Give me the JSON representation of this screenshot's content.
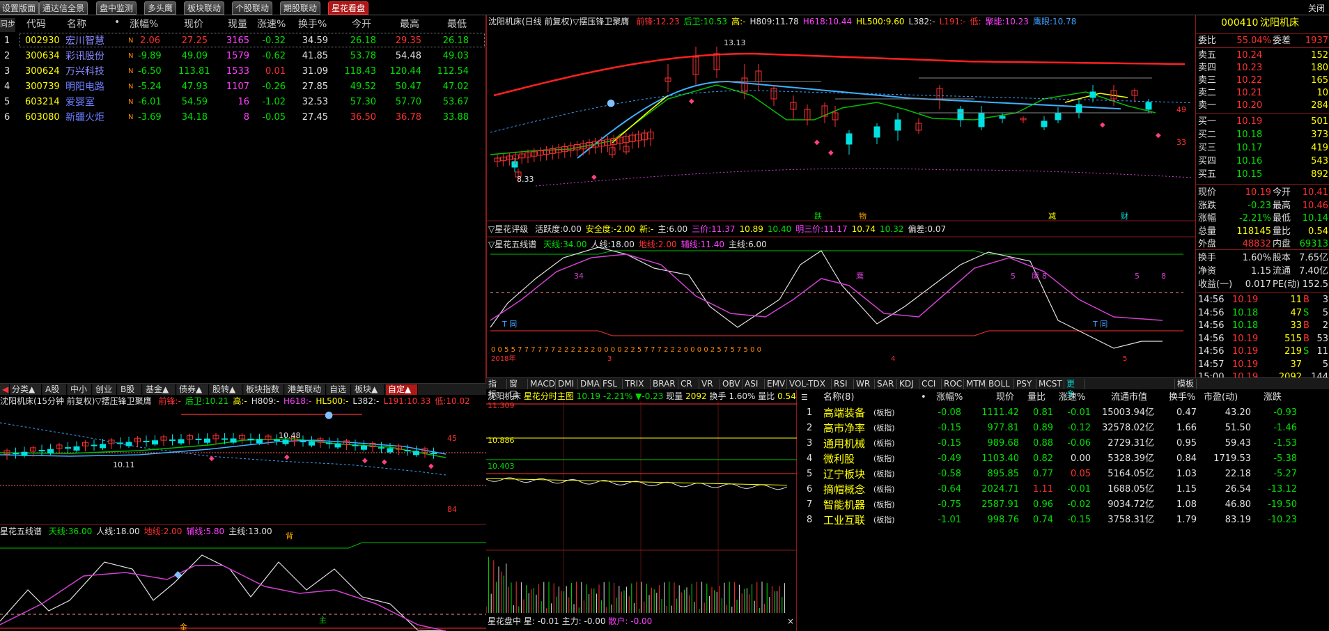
{
  "top_tabs": [
    {
      "label": "设置版面",
      "active": false
    },
    {
      "label": "通达信全景",
      "active": false
    },
    {
      "label": "盘中监测",
      "active": false
    },
    {
      "label": "多头鹰",
      "active": false
    },
    {
      "label": "板块联动",
      "active": false
    },
    {
      "label": "个股联动",
      "active": false
    },
    {
      "label": "期股联动",
      "active": false
    },
    {
      "label": "星花看盘",
      "active": true
    }
  ],
  "close_label": "关闭",
  "watchlist": {
    "headers": {
      "sync": "同步",
      "code": "代码",
      "name": "名称",
      "dot": "•",
      "chg": "涨幅%",
      "price": "现价",
      "vol": "现量",
      "speed": "涨速%",
      "turnover": "换手%",
      "open": "今开",
      "high": "最高",
      "low": "最低"
    },
    "rows": [
      {
        "idx": "1",
        "code": "002930",
        "name": "宏川智慧",
        "flag": "N",
        "chg": "2.06",
        "price": "27.25",
        "vol": "3165",
        "speed": "-0.32",
        "turnover": "34.59",
        "open": "26.18",
        "high": "29.35",
        "low": "26.18"
      },
      {
        "idx": "2",
        "code": "300634",
        "name": "彩讯股份",
        "flag": "N",
        "chg": "-9.89",
        "price": "49.09",
        "vol": "1579",
        "speed": "-0.62",
        "turnover": "41.85",
        "open": "53.78",
        "high": "54.48",
        "low": "49.03"
      },
      {
        "idx": "3",
        "code": "300624",
        "name": "万兴科技",
        "flag": "N",
        "chg": "-6.50",
        "price": "113.81",
        "vol": "1533",
        "speed": "0.01",
        "turnover": "31.09",
        "open": "118.43",
        "high": "120.44",
        "low": "112.54"
      },
      {
        "idx": "4",
        "code": "300739",
        "name": "明阳电路",
        "flag": "N",
        "chg": "-5.24",
        "price": "47.93",
        "vol": "1107",
        "speed": "-0.26",
        "turnover": "27.85",
        "open": "49.52",
        "high": "50.47",
        "low": "47.02"
      },
      {
        "idx": "5",
        "code": "603214",
        "name": "爱婴室",
        "flag": "N",
        "chg": "-6.01",
        "price": "54.59",
        "vol": "16",
        "speed": "-1.02",
        "turnover": "32.53",
        "open": "57.30",
        "high": "57.70",
        "low": "53.67"
      },
      {
        "idx": "6",
        "code": "603080",
        "name": "新疆火炬",
        "flag": "N",
        "chg": "-3.69",
        "price": "34.18",
        "vol": "8",
        "speed": "-0.05",
        "turnover": "27.45",
        "open": "36.50",
        "high": "36.78",
        "low": "33.88"
      }
    ]
  },
  "bottom_tabs": [
    {
      "label": "分类▲"
    },
    {
      "label": "A股"
    },
    {
      "label": "中小"
    },
    {
      "label": "创业"
    },
    {
      "label": "B股"
    },
    {
      "label": "基金▲"
    },
    {
      "label": "债券▲"
    },
    {
      "label": "股转▲"
    },
    {
      "label": "板块指数"
    },
    {
      "label": "港美联动"
    },
    {
      "label": "自选"
    },
    {
      "label": "板块▲"
    },
    {
      "label": "自定▲",
      "active": true
    }
  ],
  "main_chart": {
    "title": "沈阳机床(日线 前复权)▽摆压锋卫聚膺",
    "legend": [
      {
        "k": "前锋:",
        "v": "12.23",
        "c": "#ff3030"
      },
      {
        "k": "后卫:",
        "v": "10.53",
        "c": "#00e000"
      },
      {
        "k": "高:",
        "v": "-",
        "c": "#ffff00"
      },
      {
        "k": "H809:",
        "v": "11.78",
        "c": "#e0e0e0"
      },
      {
        "k": "H618:",
        "v": "10.44",
        "c": "#ff40ff"
      },
      {
        "k": "HL500:",
        "v": "9.60",
        "c": "#ffff00"
      },
      {
        "k": "L382:",
        "v": "-",
        "c": "#e0e0e0"
      },
      {
        "k": "L191:",
        "v": "-",
        "c": "#ff3030"
      },
      {
        "k": "低:",
        "v": "",
        "c": "#ff3030"
      },
      {
        "k": "聚能:",
        "v": "10.23",
        "c": "#ff40ff"
      },
      {
        "k": "鹰眼:",
        "v": "10.78",
        "c": "#40a0ff"
      }
    ],
    "annot_high": "13.13",
    "annot_low": "8.33",
    "annot_49": "49",
    "annot_33": "33",
    "signals": [
      "跌",
      "物",
      "减",
      "财"
    ],
    "rating": {
      "title": "▽星花评级",
      "items": [
        {
          "k": "活跃度:",
          "v": "0.00",
          "c": "#e0e0e0"
        },
        {
          "k": "安全度:",
          "v": "-2.00",
          "c": "#ffff00"
        },
        {
          "k": "新:",
          "v": "-",
          "c": "#ffff00"
        },
        {
          "k": "主:",
          "v": "6.00",
          "c": "#e0e0e0"
        },
        {
          "k": "三价:",
          "v": "11.37",
          "c": "#ff40ff"
        },
        {
          "k": "",
          "v": "10.89",
          "c": "#ffff00"
        },
        {
          "k": "",
          "v": "10.40",
          "c": "#00e000"
        },
        {
          "k": "明三价:",
          "v": "11.17",
          "c": "#ff40ff"
        },
        {
          "k": "",
          "v": "10.74",
          "c": "#ffff00"
        },
        {
          "k": "",
          "v": "10.32",
          "c": "#00e000"
        },
        {
          "k": "偏差:",
          "v": "0.07",
          "c": "#e0e0e0"
        }
      ]
    },
    "fiveline": {
      "title": "▽星花五线谱",
      "items": [
        {
          "k": "天线:",
          "v": "34.00",
          "c": "#00e000"
        },
        {
          "k": "人线:",
          "v": "18.00",
          "c": "#e0e0e0"
        },
        {
          "k": "地线:",
          "v": "2.00",
          "c": "#ff3030"
        },
        {
          "k": "辅线:",
          "v": "11.40",
          "c": "#ff40ff"
        },
        {
          "k": "主线:",
          "v": "6.00",
          "c": "#e0e0e0"
        }
      ]
    },
    "fl_labels": {
      "n34": "34",
      "n5a": "5",
      "n8a": "8",
      "n5b": "5",
      "n8b": "8",
      "ying1": "鹰",
      "ying2": "鹰",
      "tong1": "T 同",
      "tong2": "T 同"
    },
    "digits_row": "0  0  5  5  7  7  7  7  7  7  2  2  2  2  2  2  0  0  0  0  2      2  5  7  7  7  2  2  2  0  0  0      0  2  5  7  5  7  5  0  0",
    "date_year": "2018年",
    "date_3": "3",
    "date_4": "4",
    "date_5": "5"
  },
  "quote": {
    "code": "000410",
    "name": "沈阳机床",
    "wb": {
      "l": "委比",
      "v": "55.04%",
      "l2": "委差",
      "v2": "1937"
    },
    "sells": [
      {
        "l": "卖五",
        "p": "10.24",
        "v": "152"
      },
      {
        "l": "卖四",
        "p": "10.23",
        "v": "180"
      },
      {
        "l": "卖三",
        "p": "10.22",
        "v": "165"
      },
      {
        "l": "卖二",
        "p": "10.21",
        "v": "10"
      },
      {
        "l": "卖一",
        "p": "10.20",
        "v": "284"
      }
    ],
    "buys": [
      {
        "l": "买一",
        "p": "10.19",
        "v": "501"
      },
      {
        "l": "买二",
        "p": "10.18",
        "v": "373"
      },
      {
        "l": "买三",
        "p": "10.17",
        "v": "419"
      },
      {
        "l": "买四",
        "p": "10.16",
        "v": "543"
      },
      {
        "l": "买五",
        "p": "10.15",
        "v": "892"
      }
    ],
    "stats": [
      {
        "l": "现价",
        "v": "10.19",
        "vc": "#ff3030",
        "l2": "今开",
        "v2": "10.41",
        "v2c": "#ff3030"
      },
      {
        "l": "涨跌",
        "v": "-0.23",
        "vc": "#00e000",
        "l2": "最高",
        "v2": "10.46",
        "v2c": "#ff3030"
      },
      {
        "l": "涨幅",
        "v": "-2.21%",
        "vc": "#00e000",
        "l2": "最低",
        "v2": "10.14",
        "v2c": "#00e000"
      },
      {
        "l": "总量",
        "v": "118145",
        "vc": "#ffff00",
        "l2": "量比",
        "v2": "0.54",
        "v2c": "#ffff00"
      },
      {
        "l": "外盘",
        "v": "48832",
        "vc": "#ff3030",
        "l2": "内盘",
        "v2": "69313",
        "v2c": "#00e000"
      }
    ],
    "fund": [
      {
        "l": "换手",
        "v": "1.60%",
        "l2": "股本",
        "v2": "7.65亿"
      },
      {
        "l": "净资",
        "v": "1.15",
        "l2": "流通",
        "v2": "7.40亿"
      },
      {
        "l": "收益(一)",
        "v": "0.017",
        "l2": "PE(动)",
        "v2": "152.5"
      }
    ],
    "ticks": [
      {
        "t": "14:56",
        "p": "10.19",
        "v": "11",
        "s": "B",
        "n": "3"
      },
      {
        "t": "14:56",
        "p": "10.18",
        "v": "47",
        "s": "S",
        "n": "5"
      },
      {
        "t": "14:56",
        "p": "10.18",
        "v": "33",
        "s": "B",
        "n": "2"
      },
      {
        "t": "14:56",
        "p": "10.19",
        "v": "515",
        "s": "B",
        "n": "53"
      },
      {
        "t": "14:56",
        "p": "10.19",
        "v": "219",
        "s": "S",
        "n": "11"
      },
      {
        "t": "14:57",
        "p": "10.19",
        "v": "37",
        "s": "",
        "n": "5"
      },
      {
        "t": "15:00",
        "p": "10.19",
        "v": "2092",
        "s": "",
        "n": "144"
      }
    ]
  },
  "index_tabs": [
    "指标",
    "窗口",
    "MACD",
    "DMI",
    "DMA",
    "FSL",
    "TRIX",
    "BRAR",
    "CR",
    "VR",
    "OBV",
    "ASI",
    "EMV",
    "VOL-TDX",
    "RSI",
    "WR",
    "SAR",
    "KDJ",
    "CCI",
    "ROC",
    "MTM",
    "BOLL",
    "PSY",
    "MCST",
    "更多"
  ],
  "index_right": "模板",
  "intraday": {
    "title": "沈阳机床",
    "subtitle": "星花分时主图",
    "price": "10.19",
    "pct": "-2.21%",
    "chg": "▼-0.23",
    "vol_label": "现量",
    "vol": "2092",
    "turn_label": "换手",
    "turn": "1.60%",
    "ratio_label": "量比",
    "ratio": "0.54",
    "levels": [
      "11.309",
      "10.886",
      "10.403"
    ],
    "footer": {
      "t": "星花盘中",
      "k1": "星:",
      "v1": "-0.01",
      "k2": "主力:",
      "v2": "-0.00",
      "k3": "散户:",
      "v3": "-0.00"
    },
    "close": "×"
  },
  "sectors": {
    "headers": {
      "name": "名称(8)",
      "dot": "•",
      "chg": "涨幅%",
      "price": "现价",
      "ratio": "量比",
      "speed": "涨速%",
      "cap": "流通市值",
      "turn": "换手%",
      "pe": "市盈(动)",
      "diff": "涨跌"
    },
    "rows": [
      {
        "idx": "1",
        "name": "高端装备",
        "tag": "(板指)",
        "chg": "-0.08",
        "price": "1111.42",
        "ratio": "0.81",
        "speed": "-0.01",
        "cap": "15003.94亿",
        "turn": "0.47",
        "pe": "43.20",
        "diff": "-0.93"
      },
      {
        "idx": "2",
        "name": "高市净率",
        "tag": "(板指)",
        "chg": "-0.15",
        "price": "977.81",
        "ratio": "0.89",
        "speed": "-0.12",
        "cap": "32578.02亿",
        "turn": "1.66",
        "pe": "51.50",
        "diff": "-1.46"
      },
      {
        "idx": "3",
        "name": "通用机械",
        "tag": "(板指)",
        "chg": "-0.15",
        "price": "989.68",
        "ratio": "0.88",
        "speed": "-0.06",
        "cap": "2729.31亿",
        "turn": "0.95",
        "pe": "59.43",
        "diff": "-1.53"
      },
      {
        "idx": "4",
        "name": "微利股",
        "tag": "(板指)",
        "chg": "-0.49",
        "price": "1103.40",
        "ratio": "0.82",
        "speed": "0.00",
        "cap": "5328.39亿",
        "turn": "0.84",
        "pe": "1719.53",
        "diff": "-5.38"
      },
      {
        "idx": "5",
        "name": "辽宁板块",
        "tag": "(板指)",
        "chg": "-0.58",
        "price": "895.85",
        "ratio": "0.77",
        "speed": "0.05",
        "cap": "5164.05亿",
        "turn": "1.03",
        "pe": "22.18",
        "diff": "-5.27"
      },
      {
        "idx": "6",
        "name": "摘帽概念",
        "tag": "(板指)",
        "chg": "-0.64",
        "price": "2024.71",
        "ratio": "1.11",
        "speed": "-0.01",
        "cap": "1688.05亿",
        "turn": "1.15",
        "pe": "26.54",
        "diff": "-13.12"
      },
      {
        "idx": "7",
        "name": "智能机器",
        "tag": "(板指)",
        "chg": "-0.75",
        "price": "2587.91",
        "ratio": "0.96",
        "speed": "-0.02",
        "cap": "9034.72亿",
        "turn": "1.08",
        "pe": "46.80",
        "diff": "-19.50"
      },
      {
        "idx": "8",
        "name": "工业互联",
        "tag": "(板指)",
        "chg": "-1.01",
        "price": "998.76",
        "ratio": "0.74",
        "speed": "-0.15",
        "cap": "3758.31亿",
        "turn": "1.79",
        "pe": "83.19",
        "diff": "-10.23"
      }
    ]
  },
  "left_chart": {
    "title": "沈阳机床(15分钟 前复权)▽摆压锋卫聚膺",
    "legend": [
      {
        "k": "前锋:",
        "v": "-",
        "c": "#ff3030"
      },
      {
        "k": "后卫:",
        "v": "10.21",
        "c": "#00e000"
      },
      {
        "k": "高:",
        "v": "-",
        "c": "#ffff00"
      },
      {
        "k": "H809:",
        "v": "-",
        "c": "#e0e0e0"
      },
      {
        "k": "H618:",
        "v": "-",
        "c": "#ff40ff"
      },
      {
        "k": "HL500:",
        "v": "-",
        "c": "#ffff00"
      },
      {
        "k": "L382:",
        "v": "-",
        "c": "#e0e0e0"
      },
      {
        "k": "L191:",
        "v": "10.33",
        "c": "#ff3030"
      },
      {
        "k": "低:",
        "v": "10.02",
        "c": "#ff3030"
      }
    ],
    "annot_high": "10.48",
    "annot_low": "10.11",
    "n45": "45",
    "n84": "84",
    "fiveline": {
      "title": "星花五线谱",
      "items": [
        {
          "k": "天线:",
          "v": "36.00",
          "c": "#00e000"
        },
        {
          "k": "人线:",
          "v": "18.00",
          "c": "#e0e0e0"
        },
        {
          "k": "地线:",
          "v": "2.00",
          "c": "#ff3030"
        },
        {
          "k": "辅线:",
          "v": "5.80",
          "c": "#ff40ff"
        },
        {
          "k": "主线:",
          "v": "13.00",
          "c": "#e0e0e0"
        }
      ]
    },
    "bei": "背",
    "zhu": "主",
    "jin": "金"
  }
}
